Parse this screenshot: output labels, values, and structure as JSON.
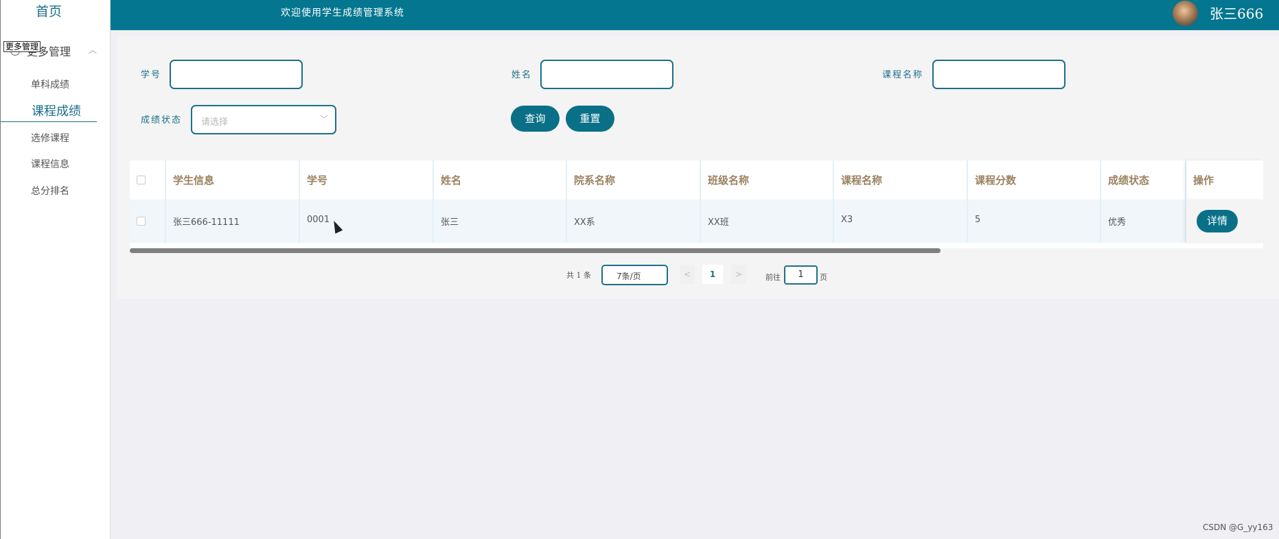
{
  "sidebar": {
    "home": "首页",
    "group_label": "更多管理",
    "tooltip": "更多管理",
    "items": [
      {
        "label": "单科成绩",
        "active": false
      },
      {
        "label": "课程成绩",
        "active": true
      },
      {
        "label": "选修课程",
        "active": false
      },
      {
        "label": "课程信息",
        "active": false
      },
      {
        "label": "总分排名",
        "active": false
      }
    ]
  },
  "header": {
    "title": "欢迎使用学生成绩管理系统",
    "username": "张三666"
  },
  "filters": {
    "student_no_label": "学号",
    "name_label": "姓名",
    "course_name_label": "课程名称",
    "status_label": "成绩状态",
    "status_placeholder": "请选择",
    "query_button": "查询",
    "reset_button": "重置"
  },
  "table": {
    "columns": [
      "学生信息",
      "学号",
      "姓名",
      "院系名称",
      "班级名称",
      "课程名称",
      "课程分数",
      "成绩状态",
      "操作"
    ],
    "rows": [
      {
        "student_info": "张三666-11111",
        "student_no": "0001",
        "name": "张三",
        "department": "XX系",
        "class": "XX班",
        "course": "X3",
        "score": "5",
        "status": "优秀",
        "action": "详情"
      }
    ]
  },
  "pagination": {
    "total": "共 1 条",
    "page_size": "7条/页",
    "current_page": "1",
    "goto_label": "前往",
    "goto_value": "1",
    "page_suffix": "页"
  },
  "watermark": "CSDN @G_yy163",
  "colors": {
    "header": "#04768f",
    "accent": "#1b6f8a",
    "button": "#0a7088",
    "column_header_text": "#9a8260"
  }
}
